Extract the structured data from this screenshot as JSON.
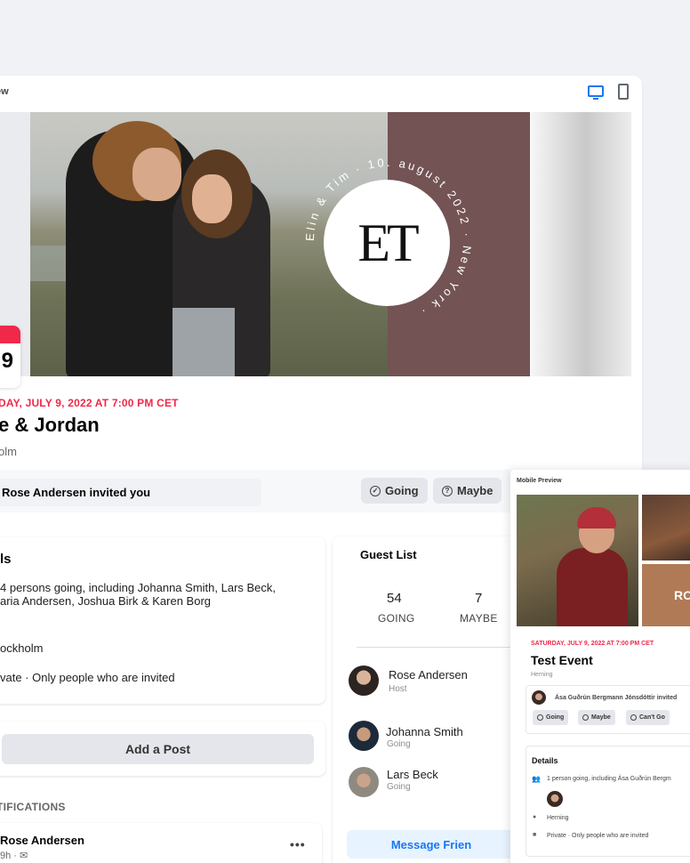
{
  "preview": {
    "label": "iew",
    "device_icons": [
      "desktop-icon",
      "mobile-icon"
    ]
  },
  "cover": {
    "monogram": "ET",
    "ring_text": "Elin & Tim · 10. august 2022 · New York ·",
    "brand_color": "#735354"
  },
  "calendar": {
    "day": "9"
  },
  "event": {
    "date": "DAY, JULY 9, 2022 AT 7:00 PM CET",
    "title": "e & Jordan",
    "location": "olm"
  },
  "actions": {
    "invited_text": "Rose Andersen invited you",
    "going_label": "Going",
    "maybe_label": "Maybe"
  },
  "details": {
    "title": "ls",
    "going_line1": "4 persons going, including Johanna Smith, Lars Beck,",
    "going_line2": "aria Andersen, Joshua Birk & Karen Borg",
    "place": "ockholm",
    "privacy": "vate  · Only people who are invited"
  },
  "post": {
    "add_label": "Add a Post"
  },
  "notifications": {
    "label": "TIFICATIONS",
    "name": "Rose Andersen",
    "meta": "9h · ✉",
    "more": "•••"
  },
  "guest_list": {
    "title": "Guest List",
    "going_count": "54",
    "going_label": "GOING",
    "maybe_count": "7",
    "maybe_label": "MAYBE",
    "guests": [
      {
        "name": "Rose Andersen",
        "role": "Host"
      },
      {
        "name": "Johanna Smith",
        "role": "Going"
      },
      {
        "name": "Lars Beck",
        "role": "Going"
      }
    ],
    "message_label": "Message Frien"
  },
  "mobile": {
    "label": "Mobile Preview",
    "photo_text": "RO",
    "date": "SATURDAY, JULY 9, 2022 AT 7:00 PM CET",
    "title": "Test Event",
    "location": "Herning",
    "invited_text": "Ása Guðrún Bergmann Jónsdóttir invited",
    "going": "Going",
    "maybe": "Maybe",
    "cant_go": "Can't Go",
    "details_title": "Details",
    "going_text": "1 person going, including Ása Guðrún Bergm",
    "place": "Herning",
    "privacy": "Private · Only people who are invited"
  },
  "colors": {
    "accent": "#1877f2",
    "date_red": "#f02849",
    "background": "#f0f2f5"
  }
}
